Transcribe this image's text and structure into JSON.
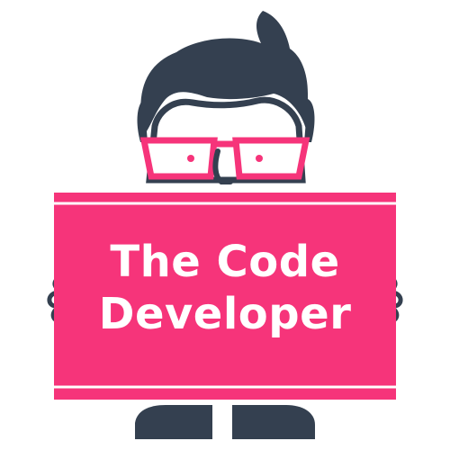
{
  "logo": {
    "line1": "The Code",
    "line2": "Developer",
    "colors": {
      "background": "#ffffff",
      "accent": "#f6347a",
      "dark": "#344050",
      "skin": "#ffffff"
    },
    "icon": "developer-mascot-icon"
  }
}
